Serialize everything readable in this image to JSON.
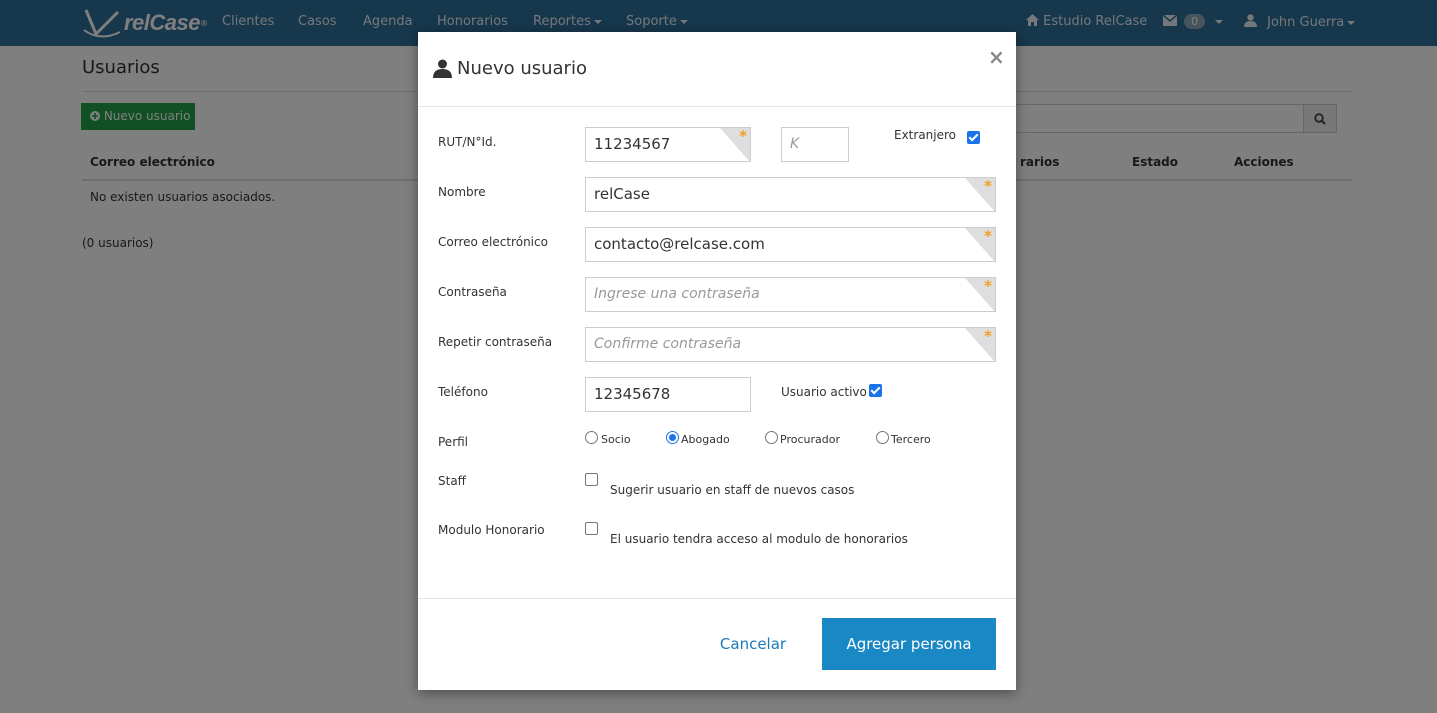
{
  "navbar": {
    "brand": "relCase",
    "brand_mark": "®",
    "items": [
      {
        "label": "Clientes"
      },
      {
        "label": "Casos"
      },
      {
        "label": "Agenda"
      },
      {
        "label": "Honorarios"
      },
      {
        "label": "Reportes"
      },
      {
        "label": "Soporte"
      }
    ],
    "studio": "Estudio RelCase",
    "messages_count": "0",
    "user": "John Guerra",
    "colors": {
      "background": "#2e6f98"
    }
  },
  "page": {
    "title": "Usuarios",
    "new_user_button": "Nuevo usuario",
    "table_headers": {
      "email": "Correo electrónico",
      "partial_profile": "rarios",
      "status": "Estado",
      "actions": "Acciones"
    },
    "empty_message": "No existen usuarios asociados.",
    "count": "(0 usuarios)"
  },
  "modal": {
    "title": "Nuevo usuario",
    "close": "×",
    "fields": {
      "rut": {
        "label": "RUT/N°Id.",
        "value": "11234567",
        "dv_placeholder": "K"
      },
      "foreign": {
        "label": "Extranjero",
        "checked": true
      },
      "name": {
        "label": "Nombre",
        "value": "relCase"
      },
      "email": {
        "label": "Correo electrónico",
        "value": "contacto@relcase.com"
      },
      "password": {
        "label": "Contraseña",
        "placeholder": "Ingrese una contraseña"
      },
      "password_repeat": {
        "label": "Repetir contraseña",
        "placeholder": "Confirme contraseña"
      },
      "phone": {
        "label": "Teléfono",
        "value": "12345678"
      },
      "active": {
        "label": "Usuario activo",
        "checked": true
      },
      "profile": {
        "label": "Perfil",
        "options": [
          "Socio",
          "Abogado",
          "Procurador",
          "Tercero"
        ],
        "selected": "Abogado"
      },
      "staff": {
        "label": "Staff",
        "text": "Sugerir usuario en staff de nuevos casos",
        "checked": false
      },
      "fees": {
        "label": "Modulo Honorario",
        "text": "El usuario tendra acceso al modulo de honorarios",
        "checked": false
      }
    },
    "required_marker": "*",
    "cancel": "Cancelar",
    "submit": "Agregar persona",
    "colors": {
      "primary": "#1a88c4",
      "required": "#f0a020"
    }
  }
}
